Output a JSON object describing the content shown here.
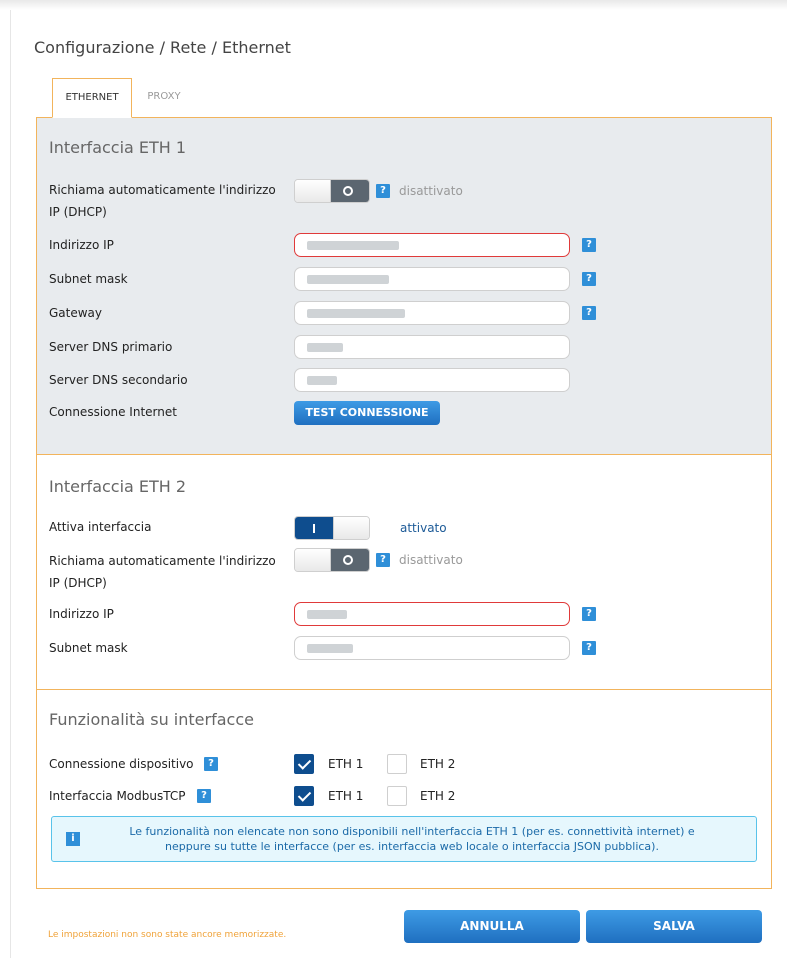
{
  "breadcrumb": "Configurazione / Rete / Ethernet",
  "tabs": [
    "ETHERNET",
    "PROXY"
  ],
  "eth1": {
    "title": "Interfaccia ETH 1",
    "dhcp_label_line1": "Richiama automaticamente l'indirizzo",
    "dhcp_label_line2": "IP (DHCP)",
    "dhcp_state": "disattivato",
    "ip_label": "Indirizzo IP",
    "subnet_label": "Subnet mask",
    "gateway_label": "Gateway",
    "dns1_label": "Server DNS primario",
    "dns2_label": "Server DNS secondario",
    "internet_label": "Connessione Internet",
    "test_button": "TEST CONNESSIONE"
  },
  "eth2": {
    "title": "Interfaccia ETH 2",
    "enable_label": "Attiva interfaccia",
    "enable_state": "attivato",
    "dhcp_label_line1": "Richiama automaticamente l'indirizzo",
    "dhcp_label_line2": "IP (DHCP)",
    "dhcp_state": "disattivato",
    "ip_label": "Indirizzo IP",
    "subnet_label": "Subnet mask"
  },
  "functions": {
    "title": "Funzionalità su interfacce",
    "device_label": "Connessione dispositivo",
    "modbus_label": "Interfaccia ModbusTCP",
    "eth1": "ETH 1",
    "eth2": "ETH 2",
    "info_line1": "Le funzionalità non elencate non sono disponibili nell'interfaccia ETH 1 (per es. connettività internet) e",
    "info_line2": "neppure su tutte le interfacce (per es. interfaccia web locale o interfaccia JSON pubblica)."
  },
  "help_glyph": "?",
  "info_glyph": "i",
  "footer": {
    "unsaved": "Le impostazioni non sono state ancore memorizzate.",
    "cancel": "ANNULLA",
    "save": "SALVA"
  },
  "colors": {
    "accent_orange": "#f2b45c",
    "primary_blue": "#1f6fc0",
    "error_red": "#e03a3a"
  }
}
